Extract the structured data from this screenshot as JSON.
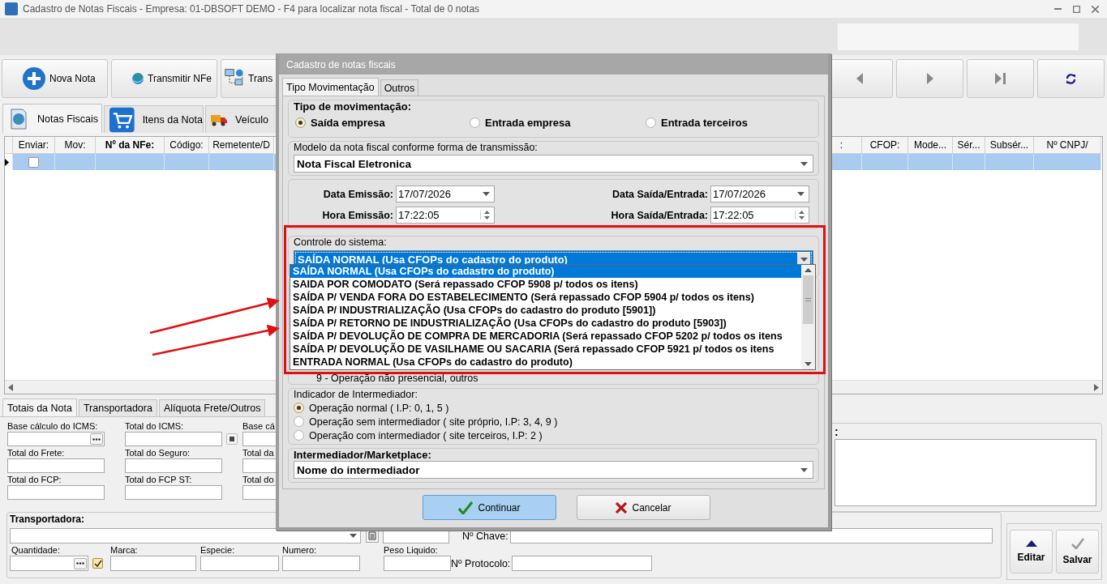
{
  "window": {
    "title": "Cadastro de Notas Fiscais - Empresa: 01-DBSOFT DEMO - F4 para localizar nota fiscal - Total de 0 notas"
  },
  "toolbar": {
    "buttons": [
      {
        "label": "Nova Nota",
        "kind": "new"
      },
      {
        "label": "Transmitir NFe",
        "kind": "globe"
      },
      {
        "label": "Trans",
        "kind": "network"
      }
    ],
    "nav_buttons": [
      {
        "kind": "prev"
      },
      {
        "kind": "next"
      },
      {
        "kind": "last"
      },
      {
        "kind": "refresh"
      }
    ]
  },
  "main_tabs": [
    {
      "label": "Notas Fiscais",
      "selected": true,
      "kind": "notes"
    },
    {
      "label": "Itens da Nota",
      "selected": false,
      "kind": "cart"
    },
    {
      "label": "Veículo",
      "selected": false,
      "kind": "truck"
    }
  ],
  "grid": {
    "columns": [
      {
        "label": "Enviar:",
        "sorted": false
      },
      {
        "label": "Mov:",
        "sorted": false
      },
      {
        "label": "Nº da NFe:",
        "sorted": true
      },
      {
        "label": "Código:",
        "sorted": false
      },
      {
        "label": "Remetente/D",
        "sorted": false
      }
    ],
    "right_columns": [
      {
        "label": ":",
        "sorted": false
      },
      {
        "label": "CFOP:",
        "sorted": false
      },
      {
        "label": "Mode...",
        "sorted": false
      },
      {
        "label": "Sér...",
        "sorted": false
      },
      {
        "label": "Subsér...",
        "sorted": false
      },
      {
        "label": "Nº CNPJ/",
        "sorted": false
      }
    ],
    "rows": [
      {
        "selected": true,
        "send_checked": false
      }
    ]
  },
  "bottom_tabs": [
    {
      "label": "Totais da Nota",
      "selected": true
    },
    {
      "label": "Transportadora",
      "selected": false
    },
    {
      "label": "Alíquota Frete/Outros",
      "selected": false
    }
  ],
  "totals": [
    {
      "label": "Base cálculo do ICMS:",
      "kind": "ellipsis"
    },
    {
      "label": "Total do ICMS:",
      "kind": "square"
    },
    {
      "label": "Base cá",
      "kind": "plain"
    },
    {
      "label": "Total do Frete:",
      "kind": "plain"
    },
    {
      "label": "Total do Seguro:",
      "kind": "plain"
    },
    {
      "label": "Total da",
      "kind": "plain"
    },
    {
      "label": "Total do FCP:",
      "kind": "plain"
    },
    {
      "label": "Total do FCP ST:",
      "kind": "plain"
    },
    {
      "label": "Total do",
      "kind": "plain"
    }
  ],
  "notes_panel": {
    "label": ":"
  },
  "transport": {
    "title": "Transportadora:",
    "quantity": {
      "label": "Quantidade:",
      "checked": true
    },
    "fields": [
      {
        "label": "Marca:"
      },
      {
        "label": "Especie:"
      },
      {
        "label": "Numero:"
      },
      {
        "label": "Peso Liquido:"
      }
    ],
    "key_label": "Nº Chave:",
    "protocol_label": "Nº Protocolo:"
  },
  "actions": [
    {
      "label": "Editar",
      "kind": "up"
    },
    {
      "label": "Salvar",
      "kind": "check"
    }
  ],
  "dialog": {
    "title": "Cadastro de notas fiscais",
    "tabs": [
      {
        "label": "Tipo Movimentação",
        "selected": true
      },
      {
        "label": "Outros",
        "selected": false
      }
    ],
    "movement": {
      "title": "Tipo de movimentação:",
      "options": [
        {
          "label": "Saída empresa",
          "selected": true
        },
        {
          "label": "Entrada empresa",
          "selected": false
        },
        {
          "label": "Entrada terceiros",
          "selected": false
        }
      ]
    },
    "model": {
      "label": "Modelo da nota fiscal conforme forma de transmissão:",
      "value": "Nota Fiscal Eletronica"
    },
    "dates": [
      {
        "label": "Data Emissão:",
        "value": "17/07/2026",
        "kind": "date"
      },
      {
        "label": "Data Saída/Entrada:",
        "value": "17/07/2026",
        "kind": "date"
      },
      {
        "label": "Hora Emissão:",
        "value": "17:22:05",
        "kind": "time"
      },
      {
        "label": "Hora Saída/Entrada:",
        "value": "17:22:05",
        "kind": "time"
      }
    ],
    "control": {
      "label": "Controle do sistema:",
      "value": "SAÍDA NORMAL (Usa CFOPs do cadastro do produto)",
      "expanded": true,
      "options": [
        {
          "label": "SAÍDA NORMAL (Usa CFOPs do cadastro do produto)",
          "selected": true
        },
        {
          "label": "SAIDA POR COMODATO (Será repassado CFOP 5908 p/ todos os itens)",
          "selected": false
        },
        {
          "label": "SAÍDA P/ VENDA FORA DO ESTABELECIMENTO (Será repassado CFOP 5904 p/ todos os itens)",
          "selected": false
        },
        {
          "label": "SAÍDA P/ INDUSTRIALIZAÇÃO (Usa CFOPs do cadastro do produto [5901])",
          "selected": false
        },
        {
          "label": "SAÍDA P/ RETORNO DE INDUSTRIALIZAÇÃO (Usa CFOPs do cadastro do produto [5903])",
          "selected": false
        },
        {
          "label": "SAÍDA P/ DEVOLUÇÃO DE COMPRA DE MERCADORIA (Será repassado CFOP 5202 p/ todos os itens",
          "selected": false
        },
        {
          "label": "SAÍDA P/ DEVOLUÇÃO DE VASILHAME OU SACARIA (Será repassado CFOP 5921 p/ todos os itens",
          "selected": false
        },
        {
          "label": "ENTRADA NORMAL (Usa CFOPs do cadastro do produto)",
          "selected": false
        }
      ]
    },
    "presence_option": "9 - Operação não presencial, outros",
    "intermediary": {
      "title": "Indicador de Intermediador:",
      "options": [
        {
          "label": "Operação normal ( I.P: 0, 1, 5 )",
          "selected": true
        },
        {
          "label": "Operação sem intermediador ( site próprio, I.P: 3, 4, 9 )",
          "selected": false
        },
        {
          "label": "Operação com intermediador ( site terceiros, I.P: 2 )",
          "selected": false
        }
      ]
    },
    "marketplace": {
      "label": "Intermediador/Marketplace:",
      "value": "Nome do intermediador"
    },
    "buttons": [
      {
        "label": "Continuar",
        "kind": "ok",
        "default": true
      },
      {
        "label": "Cancelar",
        "kind": "cancel",
        "default": false
      }
    ]
  }
}
